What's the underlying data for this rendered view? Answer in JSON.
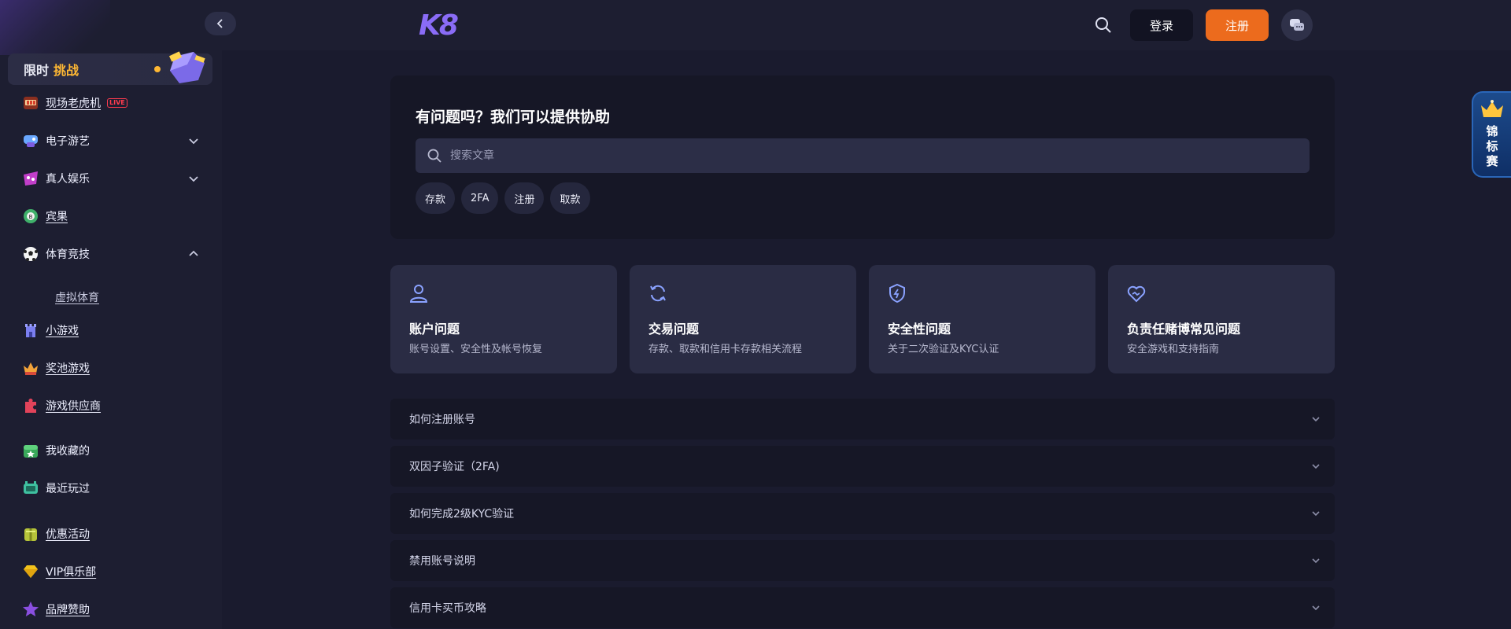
{
  "sidebar": {
    "challenge": {
      "prefix": "限时",
      "highlight": "挑战"
    },
    "items": [
      {
        "label": "现场老虎机",
        "badge": "LIVE"
      },
      {
        "label": "电子游艺"
      },
      {
        "label": "真人娱乐"
      },
      {
        "label": "宾果"
      },
      {
        "label": "体育竞技"
      },
      {
        "label": "虚拟体育"
      },
      {
        "label": "小游戏"
      },
      {
        "label": "奖池游戏"
      },
      {
        "label": "游戏供应商"
      },
      {
        "label": "我收藏的"
      },
      {
        "label": "最近玩过"
      },
      {
        "label": "优惠活动"
      },
      {
        "label": "VIP俱乐部"
      },
      {
        "label": "品牌赞助"
      }
    ]
  },
  "header": {
    "logo": "K8",
    "login_label": "登录",
    "register_label": "注册"
  },
  "help": {
    "title": "有问题吗？我们可以提供协助",
    "search_placeholder": "搜索文章",
    "tags": [
      "存款",
      "2FA",
      "注册",
      "取款"
    ]
  },
  "categories": [
    {
      "title": "账户问题",
      "desc": "账号设置、安全性及帐号恢复"
    },
    {
      "title": "交易问题",
      "desc": "存款、取款和信用卡存款相关流程"
    },
    {
      "title": "安全性问题",
      "desc": "关于二次验证及KYC认证"
    },
    {
      "title": "负责任赌博常见问题",
      "desc": "安全游戏和支持指南"
    }
  ],
  "faqs": [
    "如何注册账号",
    "双因子验证（2FA)",
    "如何完成2级KYC验证",
    "禁用账号说明",
    "信用卡买币攻略"
  ],
  "tournament": {
    "label": "锦标赛"
  },
  "colors": {
    "accent": "#ec6b1d",
    "brand": "#8a6cf6",
    "highlight": "#ffb833",
    "icon": "#8aa2ff"
  }
}
